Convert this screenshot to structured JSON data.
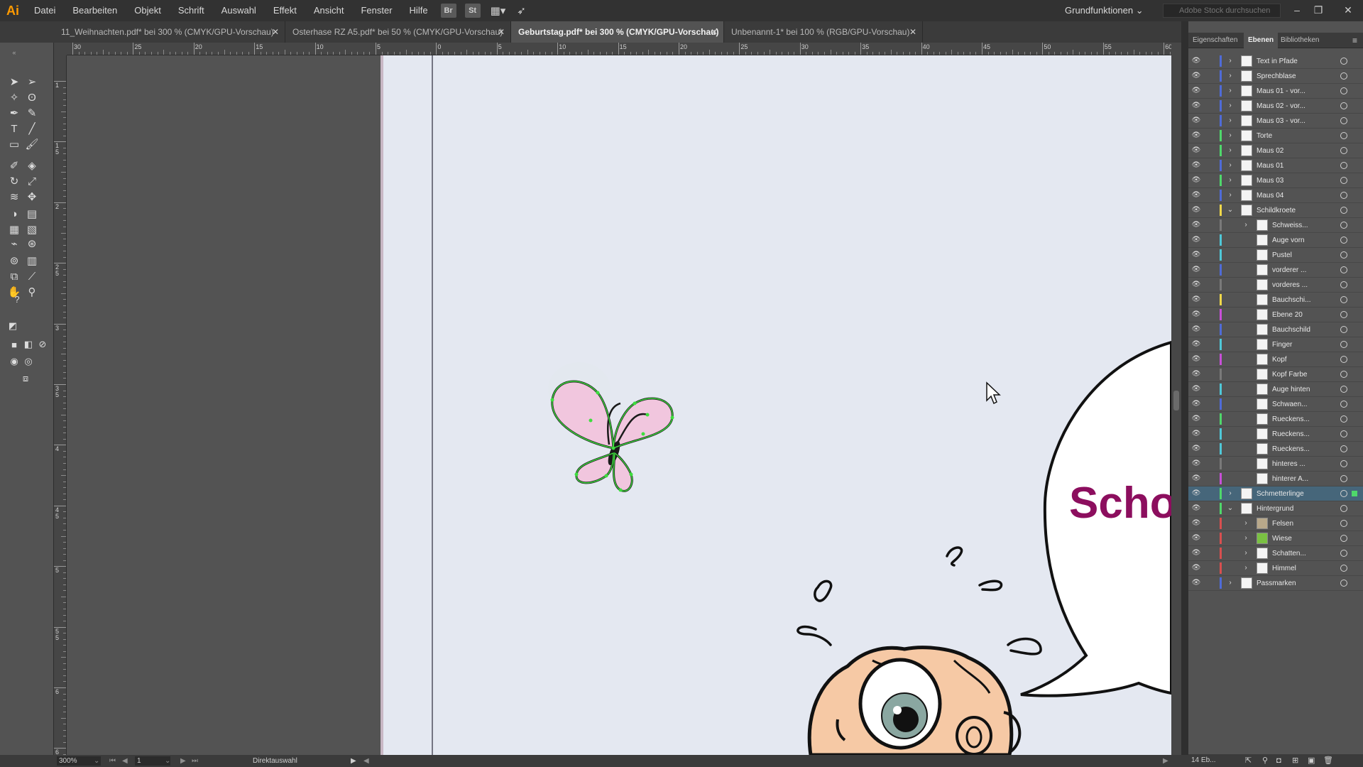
{
  "app": {
    "logo": "Ai",
    "menu": [
      "Datei",
      "Bearbeiten",
      "Objekt",
      "Schrift",
      "Auswahl",
      "Effekt",
      "Ansicht",
      "Fenster",
      "Hilfe"
    ],
    "bridge_label": "Br",
    "stock_label": "St",
    "workspace": "Grundfunktionen",
    "stock_search_placeholder": "Adobe Stock durchsuchen"
  },
  "tabs": [
    {
      "label": "11_Weihnachten.pdf* bei 300 % (CMYK/GPU-Vorschau)",
      "active": false
    },
    {
      "label": "Osterhase RZ A5.pdf* bei 50 % (CMYK/GPU-Vorschau)",
      "active": false
    },
    {
      "label": "Geburtstag.pdf* bei 300 % (CMYK/GPU-Vorschau)",
      "active": true
    },
    {
      "label": "Unbenannt-1* bei 100 % (RGB/GPU-Vorschau)",
      "active": false
    }
  ],
  "ruler": {
    "h_labels": [
      "30",
      "25",
      "20",
      "15",
      "10",
      "5",
      "0",
      "5",
      "10",
      "15",
      "20",
      "25",
      "30",
      "35",
      "40",
      "45",
      "50",
      "55",
      "60"
    ],
    "v_labels": [
      "1",
      "1 5",
      "2",
      "2 5",
      "3",
      "3 5",
      "4",
      "4 5",
      "5",
      "5 5",
      "6",
      "6 5"
    ]
  },
  "canvas": {
    "speech_text": "Scho",
    "speech_color": "#8c0e5e",
    "artboard_color": "#e4e8f1"
  },
  "status": {
    "zoom": "300%",
    "page": "1",
    "tool": "Direktauswahl"
  },
  "panel": {
    "tabs": [
      "Eigenschaften",
      "Ebenen",
      "Bibliotheken"
    ],
    "active_tab": "Ebenen",
    "layer_count": "14 Eb...",
    "layers": [
      {
        "name": "Text in Pfade",
        "level": 0,
        "expanded": false,
        "color": "#4f6bd8"
      },
      {
        "name": "Sprechblase",
        "level": 0,
        "expanded": false,
        "color": "#4f6bd8"
      },
      {
        "name": "Maus 01 - vor...",
        "level": 0,
        "expanded": false,
        "color": "#4f6bd8"
      },
      {
        "name": "Maus 02 - vor...",
        "level": 0,
        "expanded": false,
        "color": "#4f6bd8"
      },
      {
        "name": "Maus 03 - vor...",
        "level": 0,
        "expanded": false,
        "color": "#4f6bd8"
      },
      {
        "name": "Torte",
        "level": 0,
        "expanded": false,
        "color": "#4fd86b"
      },
      {
        "name": "Maus 02",
        "level": 0,
        "expanded": false,
        "color": "#4fd86b"
      },
      {
        "name": "Maus 01",
        "level": 0,
        "expanded": false,
        "color": "#4f6bd8"
      },
      {
        "name": "Maus 03",
        "level": 0,
        "expanded": false,
        "color": "#4fd86b"
      },
      {
        "name": "Maus 04",
        "level": 0,
        "expanded": false,
        "color": "#4f6bd8"
      },
      {
        "name": "Schildkroete",
        "level": 0,
        "expanded": true,
        "color": "#f0d84a"
      },
      {
        "name": "Schweiss...",
        "level": 1,
        "expanded": false,
        "color": "#7a7a7a"
      },
      {
        "name": "Auge vorn",
        "level": 1,
        "expanded": null,
        "color": "#4fc8d8"
      },
      {
        "name": "Pustel",
        "level": 1,
        "expanded": null,
        "color": "#4fc8d8"
      },
      {
        "name": "vorderer ...",
        "level": 1,
        "expanded": null,
        "color": "#4f6bd8"
      },
      {
        "name": "vorderes ...",
        "level": 1,
        "expanded": null,
        "color": "#7a7a7a"
      },
      {
        "name": "Bauchschi...",
        "level": 1,
        "expanded": null,
        "color": "#f0d84a"
      },
      {
        "name": "Ebene 20",
        "level": 1,
        "expanded": null,
        "color": "#c84fd8"
      },
      {
        "name": "Bauchschild",
        "level": 1,
        "expanded": null,
        "color": "#4f6bd8"
      },
      {
        "name": "Finger",
        "level": 1,
        "expanded": null,
        "color": "#4fc8d8"
      },
      {
        "name": "Kopf",
        "level": 1,
        "expanded": null,
        "color": "#c84fd8"
      },
      {
        "name": "Kopf Farbe",
        "level": 1,
        "expanded": null,
        "color": "#7a7a7a"
      },
      {
        "name": "Auge hinten",
        "level": 1,
        "expanded": null,
        "color": "#4fc8d8"
      },
      {
        "name": "Schwaen...",
        "level": 1,
        "expanded": null,
        "color": "#4f6bd8"
      },
      {
        "name": "Rueckens...",
        "level": 1,
        "expanded": null,
        "color": "#4fd86b"
      },
      {
        "name": "Rueckens...",
        "level": 1,
        "expanded": null,
        "color": "#4fc8d8"
      },
      {
        "name": "Rueckens...",
        "level": 1,
        "expanded": null,
        "color": "#4fc8d8"
      },
      {
        "name": "hinteres ...",
        "level": 1,
        "expanded": null,
        "color": "#7a7a7a"
      },
      {
        "name": "hinterer A...",
        "level": 1,
        "expanded": null,
        "color": "#c84fd8"
      },
      {
        "name": "Schmetterlinge",
        "level": 0,
        "expanded": false,
        "color": "#4fd86b",
        "selected": true
      },
      {
        "name": "Hintergrund",
        "level": 0,
        "expanded": true,
        "color": "#4fd86b"
      },
      {
        "name": "Felsen",
        "level": 1,
        "expanded": false,
        "color": "#d84f4f"
      },
      {
        "name": "Wiese",
        "level": 1,
        "expanded": false,
        "color": "#d84f4f"
      },
      {
        "name": "Schatten...",
        "level": 1,
        "expanded": false,
        "color": "#d84f4f"
      },
      {
        "name": "Himmel",
        "level": 1,
        "expanded": false,
        "color": "#d84f4f"
      },
      {
        "name": "Passmarken",
        "level": 0,
        "expanded": false,
        "color": "#4f6bd8"
      }
    ]
  }
}
